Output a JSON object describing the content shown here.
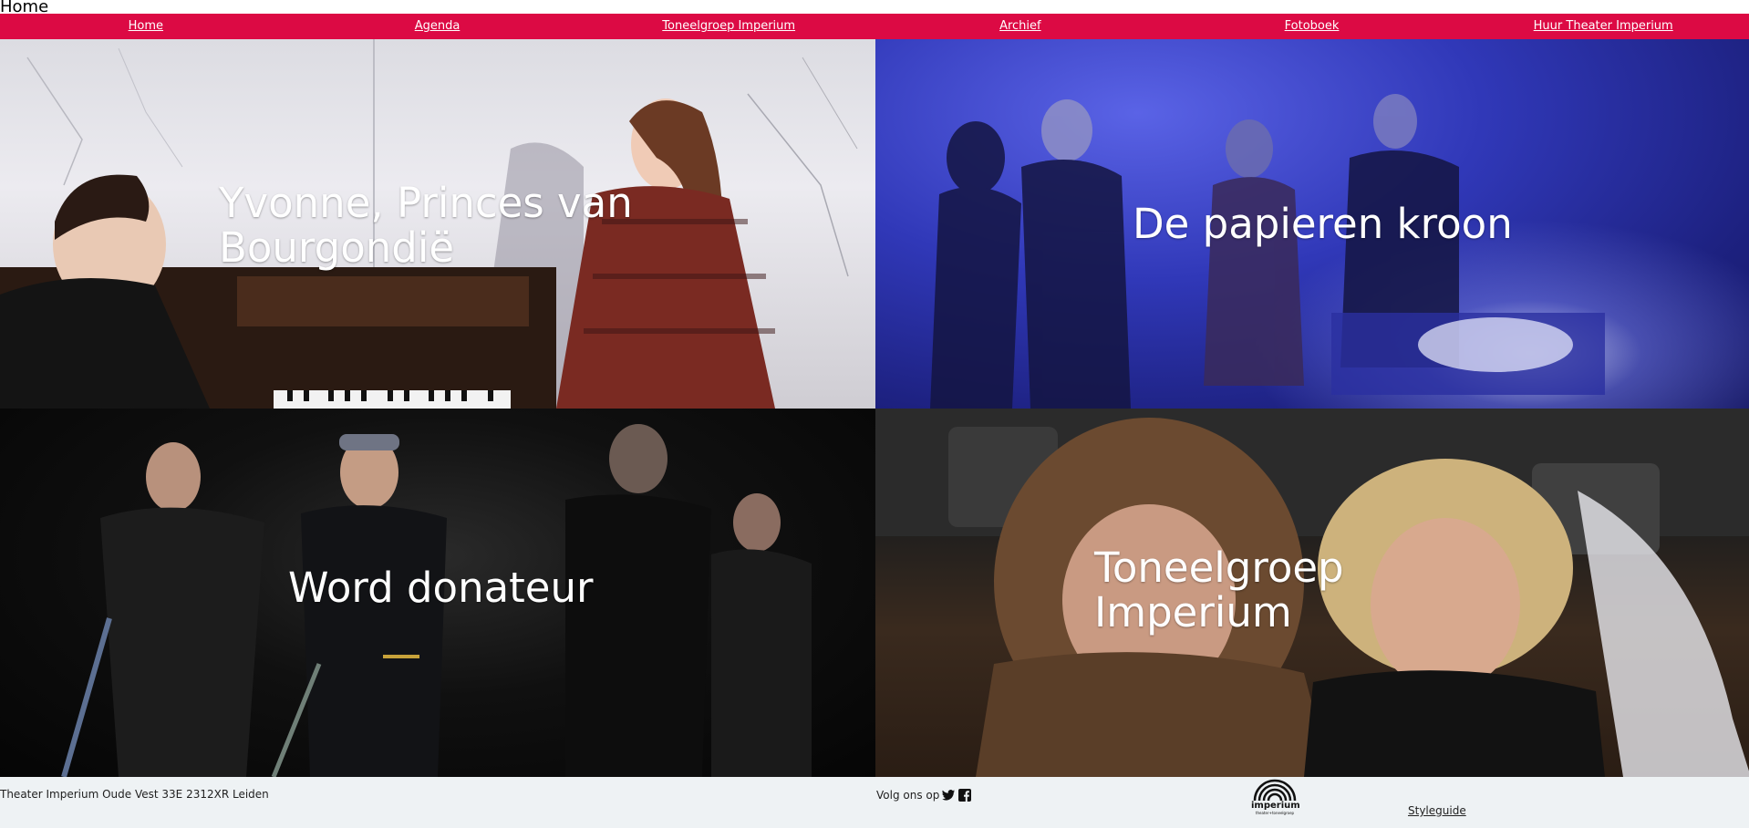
{
  "page": {
    "heading": "Home"
  },
  "nav": {
    "items": [
      {
        "label": "Home"
      },
      {
        "label": "Agenda"
      },
      {
        "label": "Toneelgroep Imperium"
      },
      {
        "label": "Archief"
      },
      {
        "label": "Fotoboek"
      },
      {
        "label": "Huur Theater Imperium"
      }
    ]
  },
  "tiles": [
    {
      "title": "Yvonne, Princes van\nBourgondië"
    },
    {
      "title": "De papieren kroon"
    },
    {
      "title": "Word donateur"
    },
    {
      "title": "Toneelgroep\nImperium"
    }
  ],
  "footer": {
    "address": "Theater Imperium Oude Vest 33E 2312XR Leiden",
    "follow_label": "Volg ons op",
    "social_icons": [
      "twitter-icon",
      "facebook-icon"
    ],
    "logo_text": "imperium",
    "logo_subtext": "theater+toneelgroep",
    "styleguide_label": "Styleguide"
  },
  "colors": {
    "nav_background": "#dc0a44",
    "footer_background": "#eef2f4",
    "title_text": "#ffffff"
  }
}
